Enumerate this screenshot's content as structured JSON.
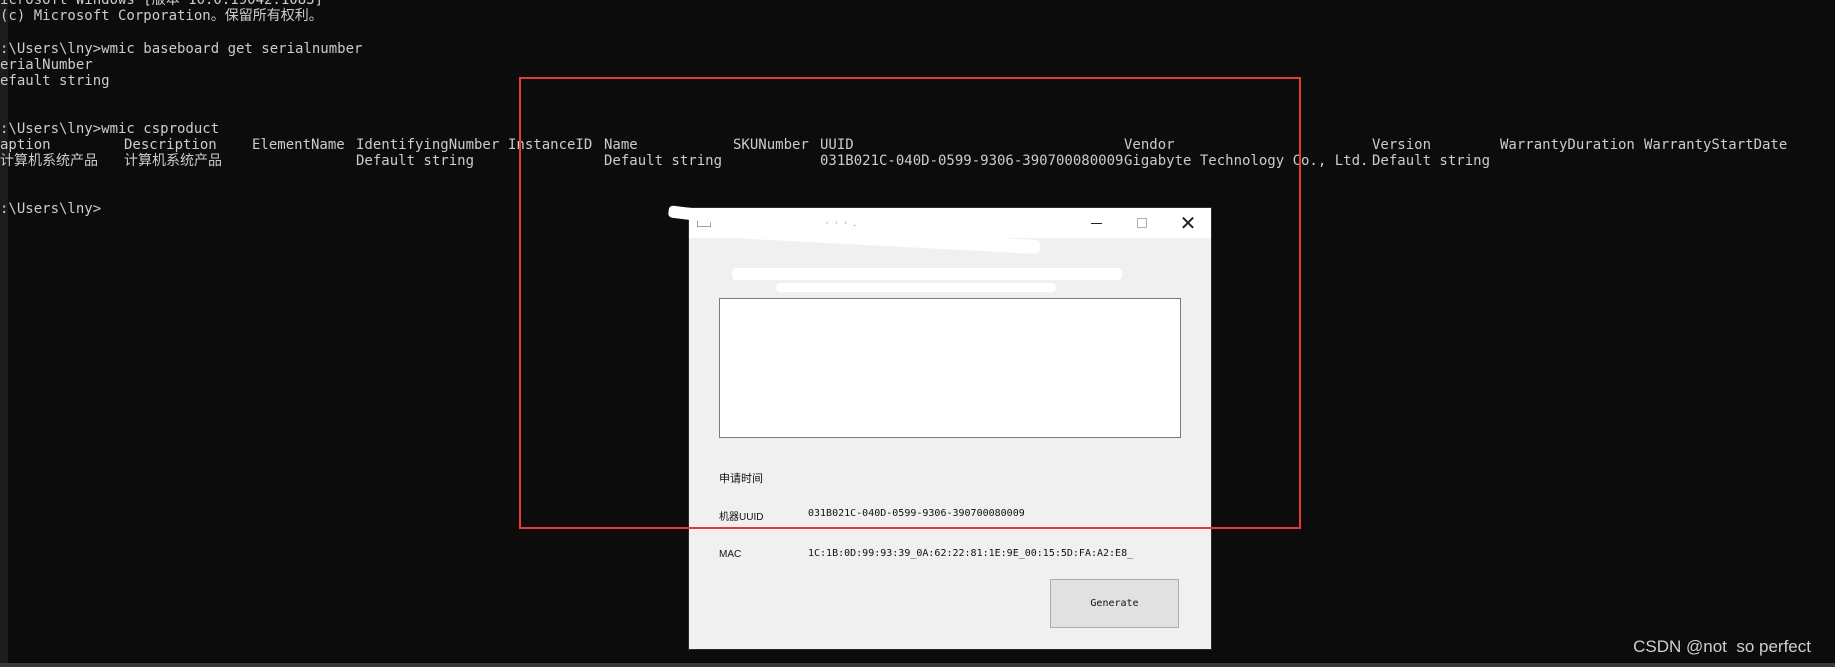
{
  "console": {
    "lines": [
      "icrosoft Windows [版本 10.0.19042.1083]",
      "(c) Microsoft Corporation。保留所有权利。",
      "",
      ":\\Users\\lny>wmic baseboard get serialnumber",
      "erialNumber",
      "efault string",
      "",
      "",
      ":\\Users\\lny>wmic csproduct"
    ],
    "table": {
      "headers": [
        "aption",
        "Description",
        "ElementName",
        "IdentifyingNumber",
        "InstanceID",
        "Name",
        "SKUNumber",
        "UUID",
        "Vendor",
        "Version",
        "WarrantyDuration",
        "WarrantyStartDate"
      ],
      "row": [
        "计算机系统产品",
        "计算机系统产品",
        "",
        "Default string",
        "",
        "Default string",
        "",
        "031B021C-040D-0599-9306-390700080009",
        "Gigabyte Technology Co., Ltd.",
        "Default string",
        "",
        ""
      ]
    },
    "prompt": ":\\Users\\lny>"
  },
  "dialog": {
    "title": "· · · .",
    "textarea_value": "",
    "labels": {
      "apply_time": "申请时间",
      "machine_uuid": "机器UUID",
      "mac": "MAC"
    },
    "values": {
      "machine_uuid": "031B021C-040D-0599-9306-390700080009",
      "mac": "1C:1B:0D:99:93:39_0A:62:22:81:1E:9E_00:15:5D:FA:A2:E8_"
    },
    "generate_label": "Generate",
    "icons": {
      "minimize": "minimize-icon",
      "maximize": "maximize-icon",
      "close": "close-icon",
      "app": "app-icon"
    }
  },
  "highlight_color": "#e53935",
  "watermark": "CSDN @not  so perfect"
}
